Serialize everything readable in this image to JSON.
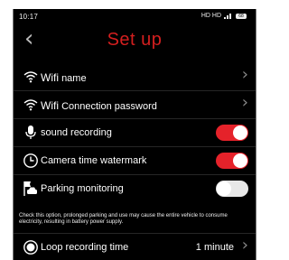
{
  "status_bar": {
    "time": "10:17",
    "indicators": "HD HD",
    "battery": "68"
  },
  "header": {
    "back_icon": "chevron-left-icon",
    "title": "Set up"
  },
  "rows": [
    {
      "prefix": "Wifi",
      "label": "name",
      "icon": "wifi-icon"
    },
    {
      "prefix": "Wifi",
      "label": "Connection password",
      "icon": "wifi-icon"
    },
    {
      "label": "sound recording",
      "icon": "microphone-icon",
      "toggle": "on"
    },
    {
      "label": "Camera time watermark",
      "icon": "clock-icon",
      "toggle": "on"
    },
    {
      "label": "Parking monitoring",
      "icon": "parking-car-icon",
      "toggle": "off"
    },
    {
      "label": "Loop recording time",
      "icon": "record-icon",
      "value": "1 minute"
    }
  ],
  "parking_note": "Check this option, prolonged parking and use may cause the entire vehicle to consume electricity, resulting in battery power supply.",
  "colors": {
    "accent": "#e5222a",
    "title": "#d41f1f",
    "background": "#000000"
  }
}
